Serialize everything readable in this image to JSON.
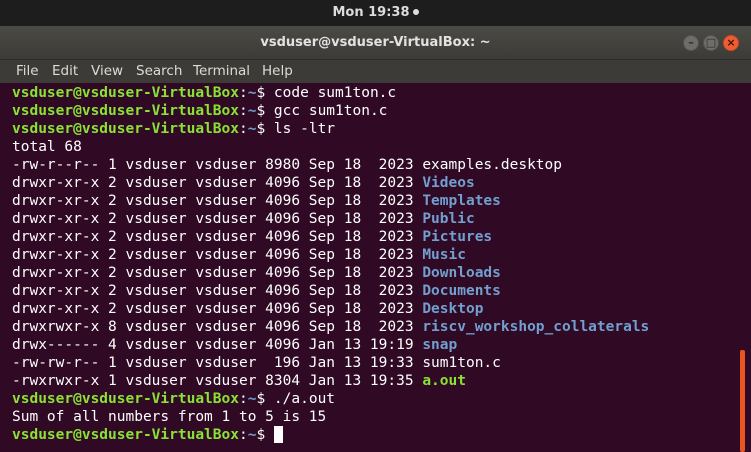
{
  "topbar": {
    "clock": "Mon 19:38"
  },
  "window": {
    "title": "vsduser@vsduser-VirtualBox: ~",
    "minimize_glyph": "–",
    "maximize_glyph": "□",
    "close_glyph": "×"
  },
  "menu": [
    "File",
    "Edit",
    "View",
    "Search",
    "Terminal",
    "Help"
  ],
  "prompt": {
    "user_host": "vsduser@vsduser-VirtualBox",
    "path": "~",
    "symbol": "$"
  },
  "commands": [
    "code sum1ton.c",
    "gcc sum1ton.c",
    "ls -ltr",
    "./a.out"
  ],
  "ls_total": "total 68",
  "files": [
    {
      "meta": "-rw-r--r-- 1 vsduser vsduser 8980 Sep 18  2023",
      "name": "examples.desktop",
      "type": "file"
    },
    {
      "meta": "drwxr-xr-x 2 vsduser vsduser 4096 Sep 18  2023",
      "name": "Videos",
      "type": "dir"
    },
    {
      "meta": "drwxr-xr-x 2 vsduser vsduser 4096 Sep 18  2023",
      "name": "Templates",
      "type": "dir"
    },
    {
      "meta": "drwxr-xr-x 2 vsduser vsduser 4096 Sep 18  2023",
      "name": "Public",
      "type": "dir"
    },
    {
      "meta": "drwxr-xr-x 2 vsduser vsduser 4096 Sep 18  2023",
      "name": "Pictures",
      "type": "dir"
    },
    {
      "meta": "drwxr-xr-x 2 vsduser vsduser 4096 Sep 18  2023",
      "name": "Music",
      "type": "dir"
    },
    {
      "meta": "drwxr-xr-x 2 vsduser vsduser 4096 Sep 18  2023",
      "name": "Downloads",
      "type": "dir"
    },
    {
      "meta": "drwxr-xr-x 2 vsduser vsduser 4096 Sep 18  2023",
      "name": "Documents",
      "type": "dir"
    },
    {
      "meta": "drwxr-xr-x 2 vsduser vsduser 4096 Sep 18  2023",
      "name": "Desktop",
      "type": "dir"
    },
    {
      "meta": "drwxrwxr-x 8 vsduser vsduser 4096 Sep 18  2023",
      "name": "riscv_workshop_collaterals",
      "type": "dir"
    },
    {
      "meta": "drwx------ 4 vsduser vsduser 4096 Jan 13 19:19",
      "name": "snap",
      "type": "dir"
    },
    {
      "meta": "-rw-rw-r-- 1 vsduser vsduser  196 Jan 13 19:33",
      "name": "sum1ton.c",
      "type": "file"
    },
    {
      "meta": "-rwxrwxr-x 1 vsduser vsduser 8304 Jan 13 19:35",
      "name": "a.out",
      "type": "exec"
    }
  ],
  "program_output": "Sum of all numbers from 1 to 5 is 15",
  "colors": {
    "terminal_bg": "#300a24",
    "prompt_user": "#8ae234",
    "prompt_path": "#729fcf",
    "directory": "#729fcf",
    "executable": "#8ae234",
    "scroll_thumb": "#e95420",
    "close_button": "#ef5c32"
  }
}
